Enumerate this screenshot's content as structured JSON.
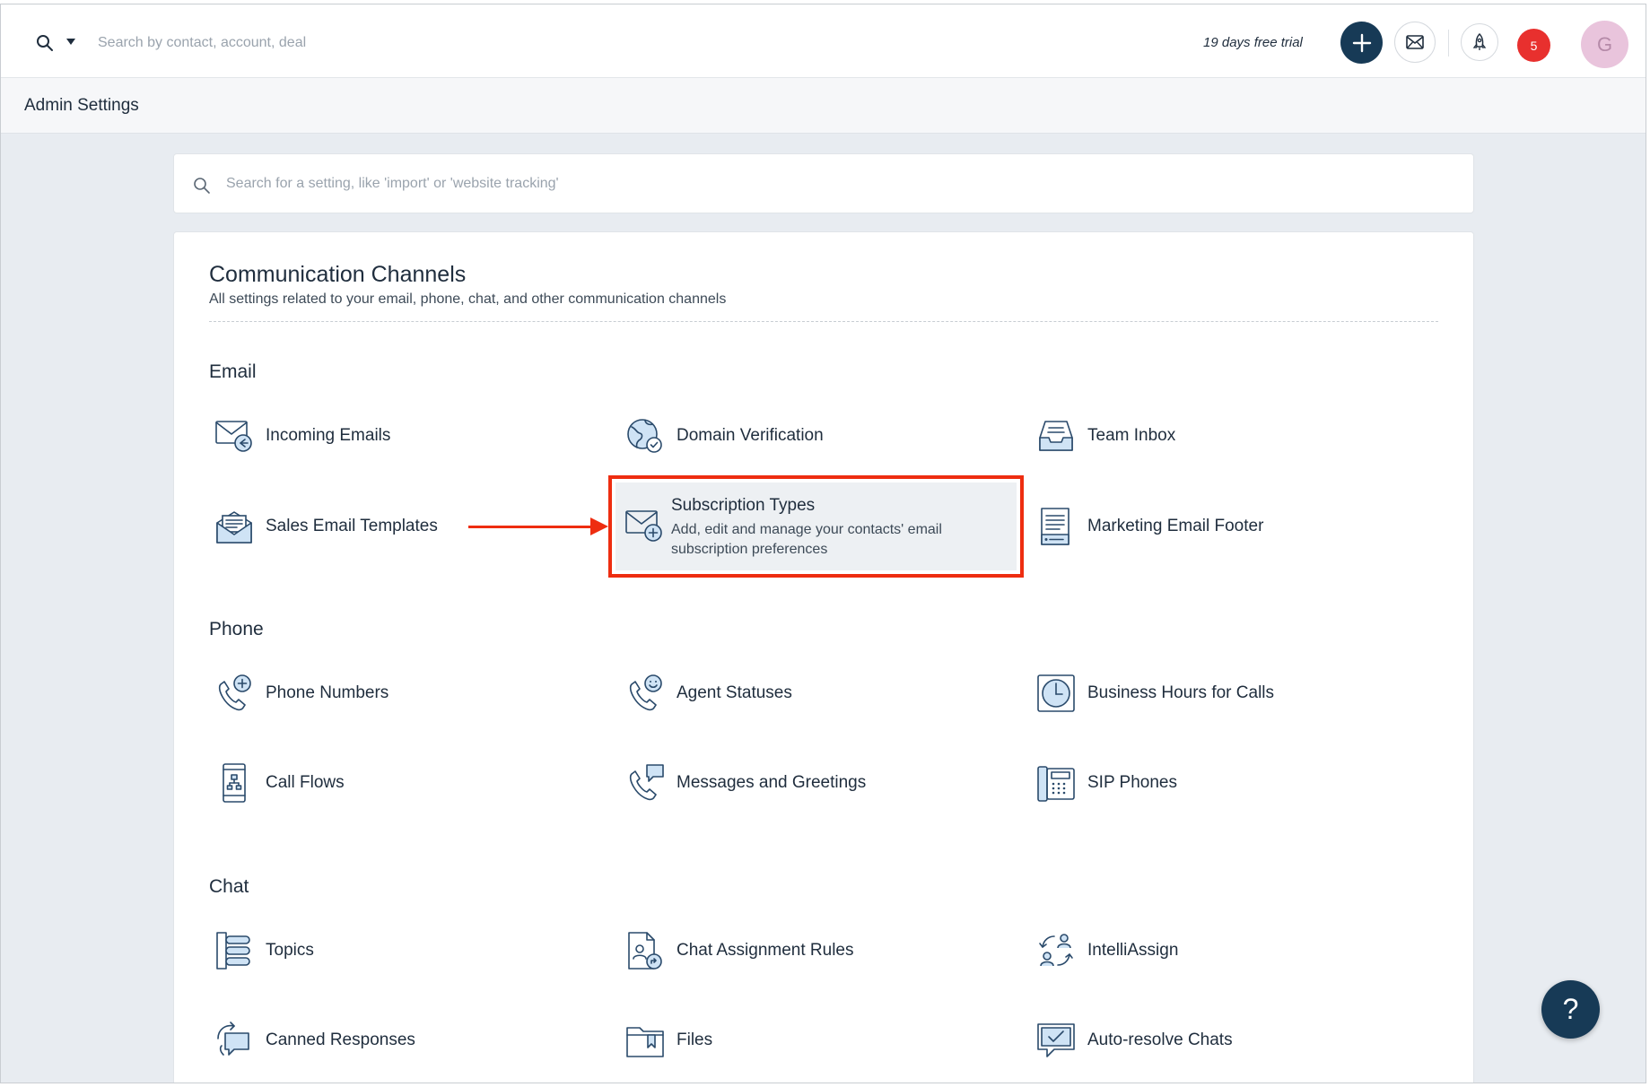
{
  "topbar": {
    "search_placeholder": "Search by contact, account, deal",
    "trial_text": "19 days free trial",
    "notification_count": "5",
    "avatar_initial": "G"
  },
  "adminbar": {
    "title": "Admin Settings"
  },
  "settings_search": {
    "placeholder": "Search for a setting, like 'import' or 'website tracking'"
  },
  "card": {
    "title": "Communication Channels",
    "subtitle": "All settings related to your email, phone, chat, and other communication channels"
  },
  "sections": {
    "email": {
      "title": "Email",
      "items": [
        {
          "label": "Incoming Emails",
          "icon": "incoming-email-icon"
        },
        {
          "label": "Domain Verification",
          "icon": "globe-check-icon"
        },
        {
          "label": "Team Inbox",
          "icon": "inbox-tray-icon"
        },
        {
          "label": "Sales Email Templates",
          "icon": "open-envelope-icon"
        },
        {
          "label": "Subscription Types",
          "icon": "envelope-plus-icon",
          "description": "Add, edit and manage your contacts' email subscription preferences"
        },
        {
          "label": "Marketing Email Footer",
          "icon": "document-footer-icon"
        }
      ]
    },
    "phone": {
      "title": "Phone",
      "items": [
        {
          "label": "Phone Numbers",
          "icon": "phone-plus-icon"
        },
        {
          "label": "Agent Statuses",
          "icon": "phone-smiley-icon"
        },
        {
          "label": "Business Hours for Calls",
          "icon": "clock-icon"
        },
        {
          "label": "Call Flows",
          "icon": "mobile-flow-icon"
        },
        {
          "label": "Messages and Greetings",
          "icon": "phone-message-icon"
        },
        {
          "label": "SIP Phones",
          "icon": "desk-phone-icon"
        }
      ]
    },
    "chat": {
      "title": "Chat",
      "items": [
        {
          "label": "Topics",
          "icon": "topics-list-icon"
        },
        {
          "label": "Chat Assignment Rules",
          "icon": "document-user-icon"
        },
        {
          "label": "IntelliAssign",
          "icon": "users-cycle-icon"
        },
        {
          "label": "Canned Responses",
          "icon": "chat-refresh-icon"
        },
        {
          "label": "Files",
          "icon": "folder-bookmark-icon"
        },
        {
          "label": "Auto-resolve Chats",
          "icon": "chat-check-icon"
        }
      ]
    }
  },
  "help": {
    "label": "?"
  },
  "colors": {
    "brand_dark": "#173a56",
    "highlight": "#ee2d10",
    "badge": "#e8302e"
  }
}
